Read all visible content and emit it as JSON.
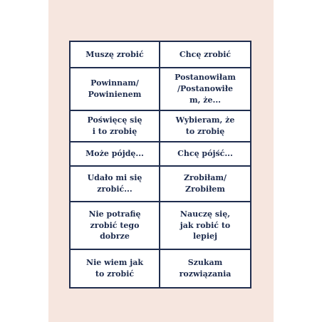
{
  "table": {
    "rows": [
      {
        "left": "Muszę zrobić",
        "right": "Chcę zrobić"
      },
      {
        "left": "Powinnam/\nPowinienem",
        "right": "Postanowiłam\n/Postanowiłe\nm, że..."
      },
      {
        "left": "Poświęcę się\ni to zrobię",
        "right": "Wybieram, że\nto zrobię"
      },
      {
        "left": "Może pójdę...",
        "right": "Chcę pójść..."
      },
      {
        "left": "Udało mi się\nzrobić...",
        "right": "Zrobiłam/\nZrobiłem"
      },
      {
        "left": "Nie potrafię\nzrobić tego\ndobrze",
        "right": "Nauczę się,\njak robić to\nlepiej"
      },
      {
        "left": "Nie wiem jak\nto zrobić",
        "right": "Szukam\nrozwiązania"
      }
    ]
  }
}
